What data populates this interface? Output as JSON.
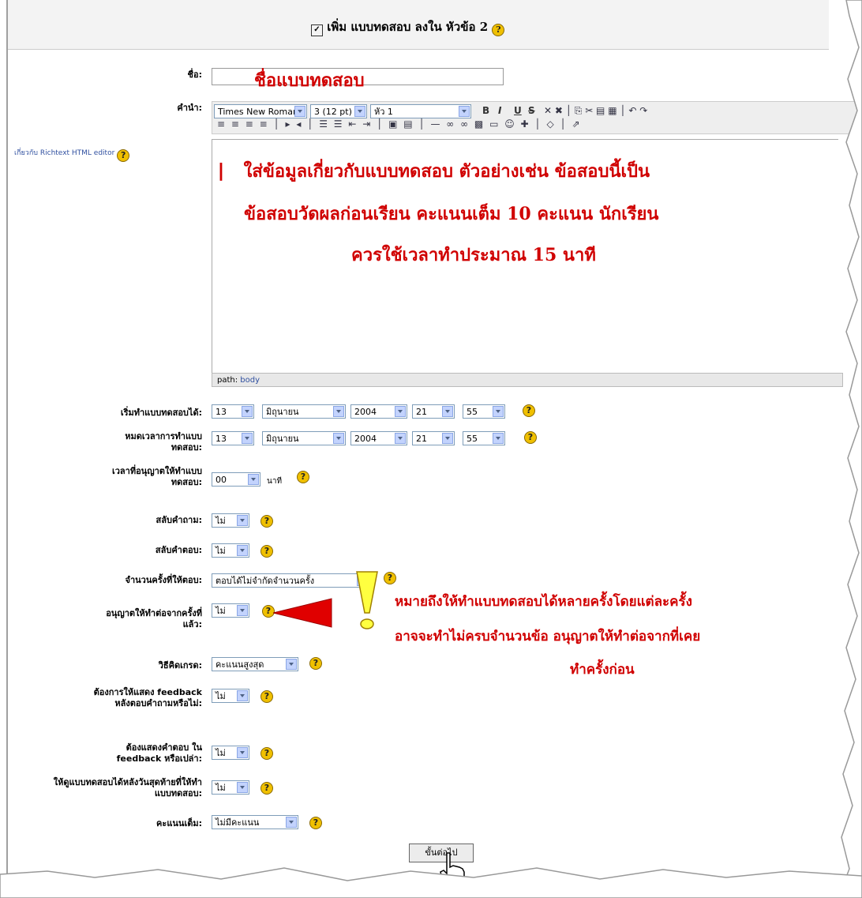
{
  "header": {
    "title": "เพิ่ม แบบทดสอบ ลงใน หัวข้อ 2"
  },
  "name_field": {
    "label": "ชื่อ:",
    "value": "ชื่อแบบทดสอบ"
  },
  "intro": {
    "label": "คำนำ:",
    "help_link": "เกี่ยวกับ Richtext HTML editor"
  },
  "toolbar": {
    "font": "Times New Roman",
    "size": "3 (12 pt)",
    "style": "หัว 1",
    "bold": "B",
    "italic": "I",
    "underline": "U",
    "strike": "S"
  },
  "editor": {
    "line1": "ใส่ข้อมูลเกี่ยวกับแบบทดสอบ ตัวอย่างเช่น ข้อสอบนี้เป็น",
    "line2": "ข้อสอบวัดผลก่อนเรียน คะแนนเต็ม 10 คะแนน นักเรียน",
    "line3": "ควรใช้เวลาทำประมาณ 15 นาที",
    "path_label": "path:",
    "path_value": "body"
  },
  "open_date": {
    "label": "เริ่มทำแบบทดสอบได้:",
    "day": "13",
    "month": "มิถุนายน",
    "year": "2004",
    "hour": "21",
    "minute": "55"
  },
  "close_date": {
    "label": "หมดเวลาการทำแบบทดสอบ:",
    "day": "13",
    "month": "มิถุนายน",
    "year": "2004",
    "hour": "21",
    "minute": "55"
  },
  "time_limit": {
    "label": "เวลาที่อนุญาตให้ทำแบบทดสอบ:",
    "value": "00",
    "unit": "นาที"
  },
  "shuffle_questions": {
    "label": "สลับคำถาม:",
    "value": "ไม่"
  },
  "shuffle_answers": {
    "label": "สลับคำตอบ:",
    "value": "ไม่"
  },
  "attempts": {
    "label": "จำนวนครั้งที่ให้ตอบ:",
    "value": "ตอบได้ไม่จำกัดจำนวนครั้ง"
  },
  "each_attempt": {
    "label": "อนุญาตให้ทำต่อจากครั้งที่แล้ว:",
    "value": "ไม่"
  },
  "grading": {
    "label": "วิธีคิดเกรด:",
    "value": "คะแนนสูงสุด"
  },
  "feedback": {
    "label": "ต้องการให้แสดง feedback หลังตอบคำถามหรือไม่:",
    "value": "ไม่"
  },
  "show_answers": {
    "label": "ต้องแสดงคำตอบ ใน feedback หรือเปล่า:",
    "value": "ไม่"
  },
  "review": {
    "label": "ให้ดูแบบทดสอบได้หลังวันสุดท้ายที่ให้ทำแบบทดสอบ:",
    "value": "ไม่"
  },
  "max_grade": {
    "label": "คะแนนเต็ม:",
    "value": "ไม่มีคะแนน"
  },
  "annotation": {
    "line1": "หมายถึงให้ทำแบบทดสอบได้หลายครั้งโดยแต่ละครั้ง",
    "line2": "อาจจะทำไม่ครบจำนวนข้อ อนุญาตให้ทำต่อจากที่เคย",
    "line3": "ทำครั้งก่อน"
  },
  "submit": {
    "label": "ขั้นต่อไป"
  }
}
